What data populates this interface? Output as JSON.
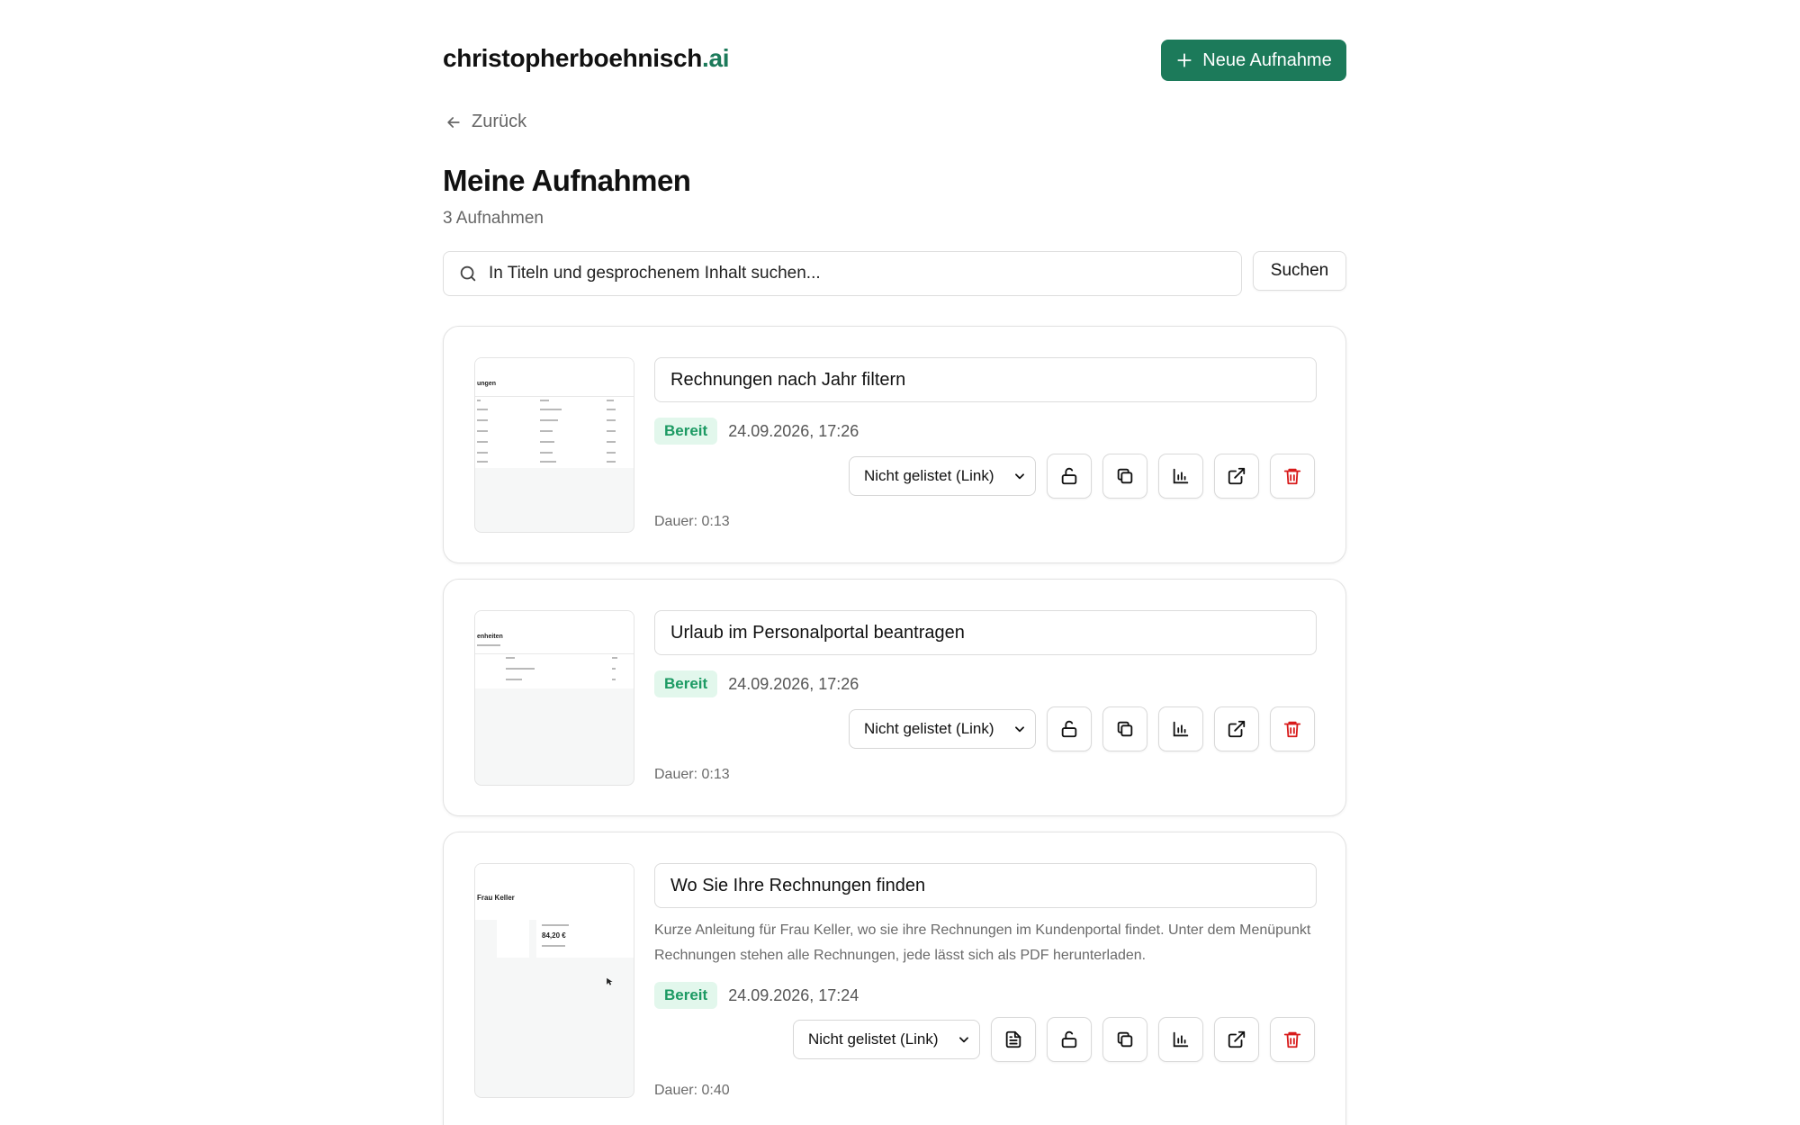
{
  "header": {
    "logo_main": "christopherboehnisch",
    "logo_tld": ".ai",
    "new_button_label": "Neue Aufnahme"
  },
  "back_label": "Zurück",
  "page_title": "Meine Aufnahmen",
  "count_label": "3 Aufnahmen",
  "search": {
    "placeholder": "In Titeln und gesprochenem Inhalt suchen...",
    "button_label": "Suchen"
  },
  "colors": {
    "accent": "#1c7a5a",
    "badge_bg": "#e2f7ec",
    "badge_text": "#1c9a63",
    "danger": "#d81b1b"
  },
  "recordings": [
    {
      "title": "Rechnungen nach Jahr filtern",
      "description": "",
      "status": "Bereit",
      "date": "24.09.2026, 17:26",
      "visibility": "Nicht gelistet (Link)",
      "duration": "Dauer: 0:13",
      "thumbnail_heading": "ungen",
      "actions": [
        "lock-open-icon",
        "copy-icon",
        "chart-icon",
        "external-link-icon",
        "trash-icon"
      ]
    },
    {
      "title": "Urlaub im Personalportal beantragen",
      "description": "",
      "status": "Bereit",
      "date": "24.09.2026, 17:26",
      "visibility": "Nicht gelistet (Link)",
      "duration": "Dauer: 0:13",
      "thumbnail_heading": "enheiten",
      "actions": [
        "lock-open-icon",
        "copy-icon",
        "chart-icon",
        "external-link-icon",
        "trash-icon"
      ]
    },
    {
      "title": "Wo Sie Ihre Rechnungen finden",
      "description": "Kurze Anleitung für Frau Keller, wo sie ihre Rechnungen im Kundenportal findet. Unter dem Menüpunkt Rechnungen stehen alle Rechnungen, jede lässt sich als PDF herunterladen.",
      "status": "Bereit",
      "date": "24.09.2026, 17:24",
      "visibility": "Nicht gelistet (Link)",
      "duration": "Dauer: 0:40",
      "thumbnail_heading": "Frau Keller",
      "thumbnail_amount": "84,20 €",
      "actions": [
        "document-icon",
        "lock-open-icon",
        "copy-icon",
        "chart-icon",
        "external-link-icon",
        "trash-icon"
      ]
    }
  ]
}
